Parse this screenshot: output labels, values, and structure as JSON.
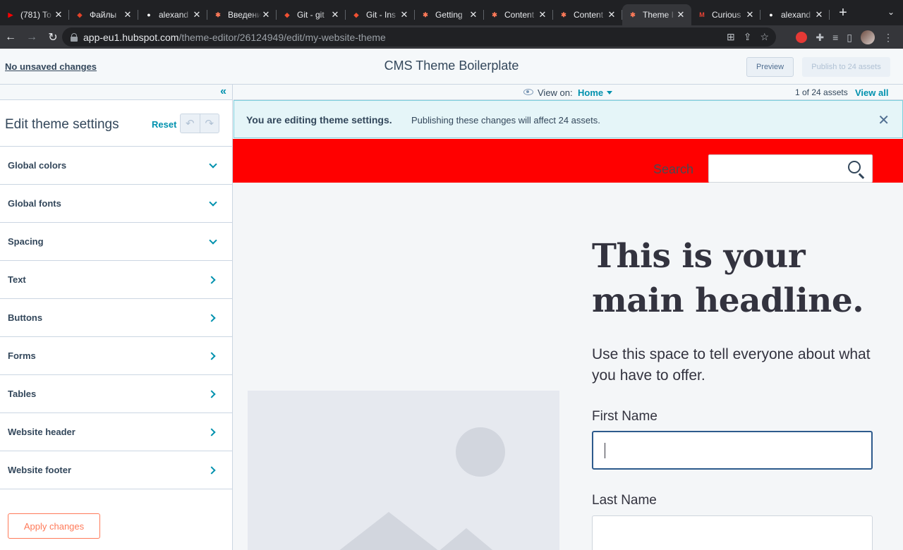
{
  "browser": {
    "tabs": [
      {
        "title": "(781) To",
        "icon": "youtube-icon",
        "color": "#ff0000",
        "glyph": "▶"
      },
      {
        "title": "Файлы",
        "icon": "gitlab-icon",
        "color": "#e24329",
        "glyph": "◆"
      },
      {
        "title": "alexand",
        "icon": "github-icon",
        "color": "#ffffff",
        "glyph": "●"
      },
      {
        "title": "Введени",
        "icon": "hubspot-icon",
        "color": "#ff7a59",
        "glyph": "✱"
      },
      {
        "title": "Git - git",
        "icon": "git-icon",
        "color": "#f05133",
        "glyph": "◆"
      },
      {
        "title": "Git - Ins",
        "icon": "git-icon",
        "color": "#f05133",
        "glyph": "◆"
      },
      {
        "title": "Getting",
        "icon": "hubspot-icon",
        "color": "#ff7a59",
        "glyph": "✱"
      },
      {
        "title": "Content",
        "icon": "hubspot-icon",
        "color": "#ff7a59",
        "glyph": "✱"
      },
      {
        "title": "Content",
        "icon": "hubspot-icon",
        "color": "#ff7a59",
        "glyph": "✱"
      },
      {
        "title": "Theme I",
        "icon": "hubspot-icon",
        "color": "#ff7a59",
        "glyph": "✱",
        "active": true
      },
      {
        "title": "Curious",
        "icon": "gmail-icon",
        "color": "#ea4335",
        "glyph": "M"
      },
      {
        "title": "alexand",
        "icon": "github-icon",
        "color": "#ffffff",
        "glyph": "●"
      }
    ],
    "url_host": "app-eu1.hubspot.com",
    "url_path": "/theme-editor/26124949/edit/my-website-theme"
  },
  "header": {
    "unsaved": "No unsaved changes",
    "title": "CMS Theme Boilerplate",
    "preview_label": "Preview",
    "publish_label": "Publish to 24 assets"
  },
  "sidebar": {
    "title": "Edit theme settings",
    "reset_label": "Reset",
    "items": [
      {
        "label": "Global colors",
        "chevron": "down"
      },
      {
        "label": "Global fonts",
        "chevron": "down"
      },
      {
        "label": "Spacing",
        "chevron": "down"
      },
      {
        "label": "Text",
        "chevron": "right"
      },
      {
        "label": "Buttons",
        "chevron": "right"
      },
      {
        "label": "Forms",
        "chevron": "right"
      },
      {
        "label": "Tables",
        "chevron": "right"
      },
      {
        "label": "Website header",
        "chevron": "right"
      },
      {
        "label": "Website footer",
        "chevron": "right"
      }
    ],
    "apply_label": "Apply changes"
  },
  "viewbar": {
    "view_on_label": "View on:",
    "view_on_value": "Home",
    "asset_count": "1 of 24 assets",
    "view_all": "View all"
  },
  "banner": {
    "strong": "You are editing theme settings.",
    "text": "Publishing these changes will affect 24 assets."
  },
  "site": {
    "search_label": "Search",
    "headline": "This is your main headline.",
    "subtext": "Use this space to tell everyone about what you have to offer.",
    "field1_label": "First Name",
    "field2_label": "Last Name"
  },
  "colors": {
    "accent": "#0091ae",
    "hubspot_orange": "#ff7a59",
    "site_header": "#ff0000"
  }
}
